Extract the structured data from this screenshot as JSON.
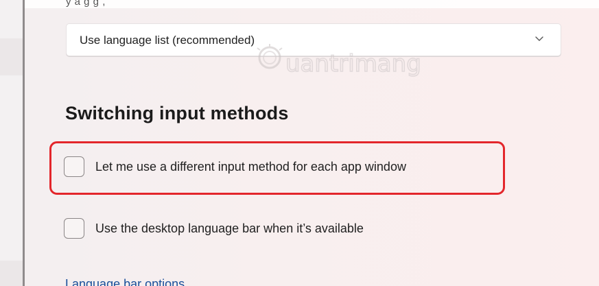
{
  "header": {
    "cut_text": "y   a   g   g   ,"
  },
  "dropdown": {
    "value": "Use language list (recommended)"
  },
  "watermark": {
    "text": "uantrimang"
  },
  "section": {
    "title": "Switching input methods"
  },
  "options": [
    {
      "label": "Let me use a different input method for each app window",
      "checked": false,
      "highlighted": true
    },
    {
      "label": "Use the desktop language bar when it’s available",
      "checked": false,
      "highlighted": false
    }
  ],
  "link": {
    "label": "Language bar options"
  },
  "colors": {
    "highlight": "#e3262b",
    "link": "#1a4f9a",
    "background": "#f8efef"
  },
  "icons": {
    "dropdown": "chevron-down-icon"
  }
}
